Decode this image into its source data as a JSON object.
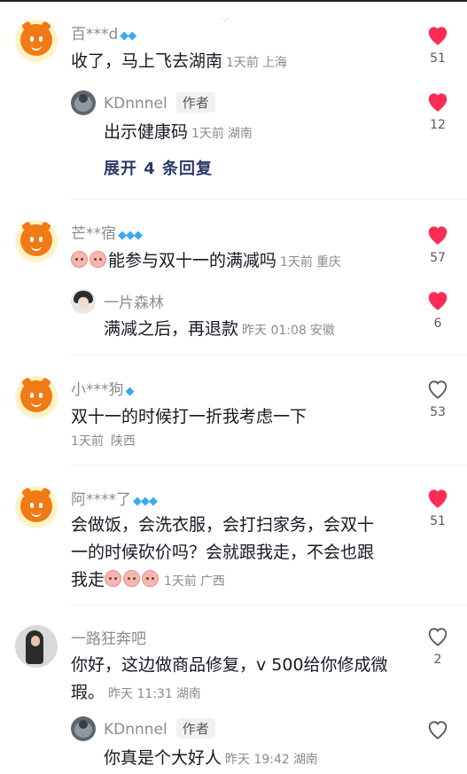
{
  "colors": {
    "liked": "#fe2c55",
    "text": "#161823",
    "meta": "#8a8b91",
    "expand": "#2a3a6a",
    "diamond": "#38a8f2"
  },
  "comments": [
    {
      "user": "百***d",
      "text": "收了，马上飞去湖南",
      "time": "1天前",
      "location": "上海",
      "likes": "51",
      "liked": true,
      "reply": {
        "user": "KDnnnel",
        "tag": "作者",
        "text": "出示健康码",
        "time": "1天前",
        "location": "湖南",
        "likes": "12",
        "liked": true
      },
      "expand": "展开 4 条回复"
    },
    {
      "user": "芒**宿",
      "text": "能参与双十一的满减吗",
      "time": "1天前",
      "location": "重庆",
      "likes": "57",
      "liked": true,
      "reply": {
        "user": "一片森林",
        "text": "满减之后，再退款",
        "time": "昨天 01:08",
        "location": "安徽",
        "likes": "6",
        "liked": true
      }
    },
    {
      "user": "小***狗",
      "text": "双十一的时候打一折我考虑一下",
      "time": "1天前",
      "location": "陕西",
      "likes": "53",
      "liked": false
    },
    {
      "user": "阿****了",
      "text": "会做饭，会洗衣服，会打扫家务，会双十一的时候砍价吗？会就跟我走，不会也跟我走",
      "time": "1天前",
      "location": "广西",
      "likes": "51",
      "liked": true
    },
    {
      "user": "一路狂奔吧",
      "text": "你好，这边做商品修复，v 500给你修成微瑕。",
      "time": "昨天 11:31",
      "location": "湖南",
      "likes": "2",
      "liked": false,
      "reply": {
        "user": "KDnnnel",
        "tag": "作者",
        "text": "你真是个大好人",
        "time": "昨天 19:42",
        "location": "湖南",
        "liked": false
      }
    }
  ]
}
